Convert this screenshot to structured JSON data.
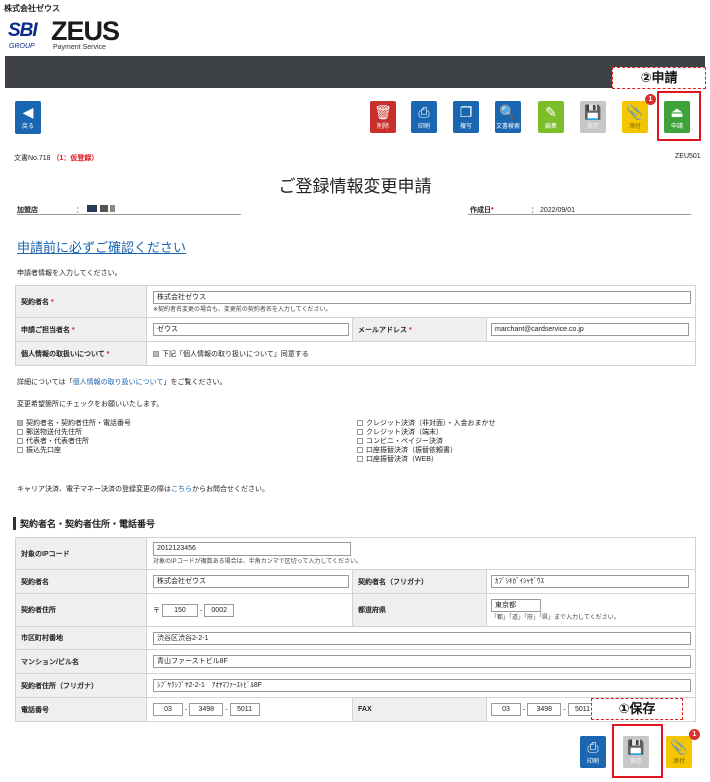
{
  "header": {
    "company": "株式会社ゼウス",
    "logo_sbi": "SBI",
    "logo_zeus": "ZEUS",
    "logo_group": "GROUP",
    "logo_ps": "Payment Service",
    "bar_color": "#3e4145"
  },
  "callouts": {
    "apply": "②申請",
    "save": "①保存"
  },
  "toolbar": {
    "back": "戻る",
    "delete": "削除",
    "print": "印刷",
    "copy": "複写",
    "doc_search": "文書検索",
    "edit": "編集",
    "save": "保存",
    "attach": "添付",
    "apply": "申請",
    "attach_badge": "1"
  },
  "doc": {
    "number_label": "文書No.718",
    "status": "（1：仮登録）",
    "code": "ZEU501",
    "title": "ご登録情報変更申請",
    "shop_label": "加盟店",
    "shop_sep": "：",
    "created_label": "作成日",
    "required_mark": "*",
    "created_value": "： 2022/09/01"
  },
  "notice": {
    "link": "申請前に必ずご確認ください",
    "intro": "申請者情報を入力してください。"
  },
  "applicant": {
    "contract_name_label": "契約者名",
    "contract_name_value": "株式会社ゼウス",
    "contract_name_hint": "※契約者名変更の場合も、変更前の契約者名を入力してください。",
    "person_label": "申請ご担当者名",
    "person_value": "ゼウス",
    "email_label": "メールアドレス",
    "email_value": "marchant@cardservice.co.jp",
    "privacy_label": "個人情報の取扱いについて",
    "privacy_check": "下記「個人情報の取り扱いについて」同意する"
  },
  "privacy_note": {
    "before": "詳細については「",
    "link": "個人情報の取り扱いについて",
    "after": "」をご覧ください。"
  },
  "check_intro": "変更希望箇所にチェックをお願いいたします。",
  "checks_left": [
    {
      "label": "契約者名・契約者住所・電話番号",
      "checked": true
    },
    {
      "label": "郵送物送付先住所",
      "checked": false
    },
    {
      "label": "代表者・代表者住所",
      "checked": false
    },
    {
      "label": "振込先口座",
      "checked": false
    }
  ],
  "checks_right": [
    {
      "label": "クレジット決済（非対面）・入金おまかせ",
      "checked": false
    },
    {
      "label": "クレジット決済（端末）",
      "checked": false
    },
    {
      "label": "コンビニ・ペイジー決済",
      "checked": false
    },
    {
      "label": "口座振替決済（振替依頼書）",
      "checked": false
    },
    {
      "label": "口座振替決済（WEB）",
      "checked": false
    }
  ],
  "carrier_note": {
    "before": "キャリア決済、電子マネー決済の登録変更の際は",
    "link": "こちら",
    "after": "からお問合せください。"
  },
  "section": {
    "heading": "契約者名・契約者住所・電話番号",
    "ip_label": "対象のIPコード",
    "ip_value": "2012123456",
    "ip_hint": "対象のIPコードが複数ある場合は、半角カンマで区切って入力してください。",
    "name_label": "契約者名",
    "name_value": "株式会社ゼウス",
    "kana_label": "契約者名（フリガナ）",
    "kana_value": "ｶﾌﾞｼｷｶﾞｲｼｬｾﾞｳｽ",
    "addr_label": "契約者住所",
    "zip_mark": "〒",
    "zip1": "150",
    "zip_sep": "-",
    "zip2": "0002",
    "pref_label": "都道府県",
    "pref_value": "東京都",
    "pref_hint": "「都」「道」「府」「県」まで入力してください。",
    "city_label": "市区町村番地",
    "city_value": "渋谷区渋谷2-2-1",
    "building_label": "マンション/ビル名",
    "building_value": "青山ファーストビル8F",
    "addr_kana_label": "契約者住所（フリガナ）",
    "addr_kana_value": "ｼﾌﾞﾔｸｼﾌﾞﾔ2-2-1　ｱｵﾔﾏﾌｧｰｽﾄﾋﾞﾙ8F",
    "tel_label": "電話番号",
    "tel1": "03",
    "tel2": "3498",
    "tel3": "5011",
    "fax_label": "FAX",
    "fax1": "03",
    "fax2": "3498",
    "fax3": "5011"
  },
  "bottom": {
    "print": "印刷",
    "save": "保存",
    "attach": "添付",
    "attach_badge": "1"
  }
}
